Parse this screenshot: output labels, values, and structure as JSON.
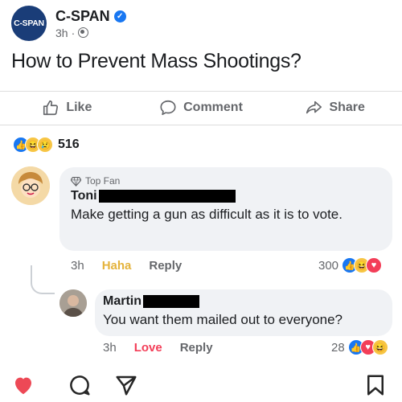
{
  "post": {
    "page_name": "C-SPAN",
    "avatar_label": "C-SPAN",
    "time": "3h",
    "time_sep": "·",
    "text": "How to Prevent Mass Shootings?"
  },
  "actions": {
    "like": "Like",
    "comment": "Comment",
    "share": "Share"
  },
  "reactions": {
    "count": "516",
    "types": [
      "like-icon",
      "haha-icon",
      "sad-icon"
    ]
  },
  "comments": [
    {
      "badge": "Top Fan",
      "name": "Toni",
      "text": "Make getting a gun as difficult as it is to vote.",
      "time": "3h",
      "reaction_label": "Haha",
      "reply_label": "Reply",
      "reaction_count": "300"
    },
    {
      "name": "Martin",
      "text": "You want them mailed out to everyone?",
      "time": "3h",
      "reaction_label": "Love",
      "reply_label": "Reply",
      "reaction_count": "28"
    }
  ],
  "colors": {
    "facebook_blue": "#1877f2",
    "cspan_navy": "#1a3d78",
    "love_red": "#f33e58",
    "haha_yellow": "#f7c544"
  },
  "bottom_bar": {
    "icons": [
      "heart-icon",
      "comment-bubble-icon",
      "send-icon",
      "bookmark-icon"
    ]
  }
}
